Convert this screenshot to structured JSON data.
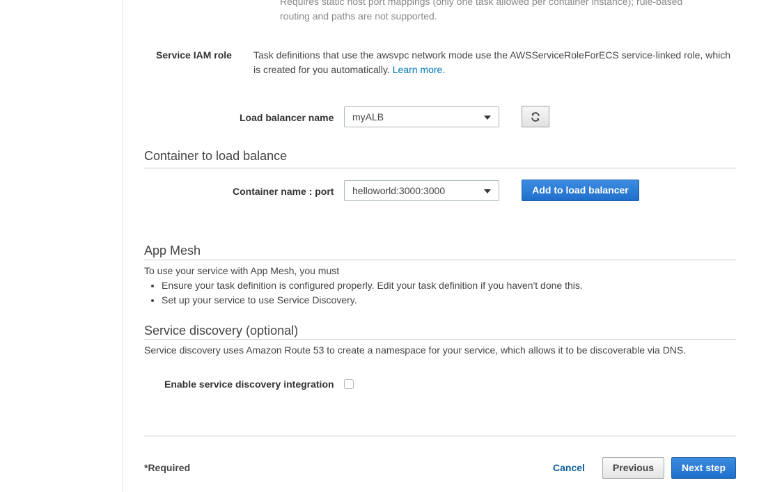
{
  "top_cutoff": {
    "line1": "Requires static host port mappings (only one task allowed per container instance); rule-based",
    "line2": "routing and paths are not supported."
  },
  "service_iam_role": {
    "label": "Service IAM role",
    "text": "Task definitions that use the awsvpc network mode use the AWSServiceRoleForECS service-linked role, which is created for you automatically.",
    "link": "Learn more."
  },
  "load_balancer": {
    "label": "Load balancer name",
    "selected": "myALB",
    "refresh_icon": "refresh-icon"
  },
  "container_section": {
    "title": "Container to load balance",
    "label": "Container name : port",
    "selected": "helloworld:3000:3000",
    "add_button": "Add to load balancer"
  },
  "app_mesh": {
    "title": "App Mesh",
    "intro": "To use your service with App Mesh, you must",
    "bullets": [
      "Ensure your task definition is configured properly. Edit your task definition if you haven't done this.",
      "Set up your service to use Service Discovery."
    ]
  },
  "service_discovery": {
    "title": "Service discovery (optional)",
    "text": "Service discovery uses Amazon Route 53 to create a namespace for your service, which allows it to be discoverable via DNS.",
    "checkbox_label": "Enable service discovery integration"
  },
  "footer": {
    "required": "*Required",
    "cancel": "Cancel",
    "previous": "Previous",
    "next": "Next step"
  },
  "colors": {
    "link": "#0073bb",
    "primary": "#1f6fcc"
  }
}
